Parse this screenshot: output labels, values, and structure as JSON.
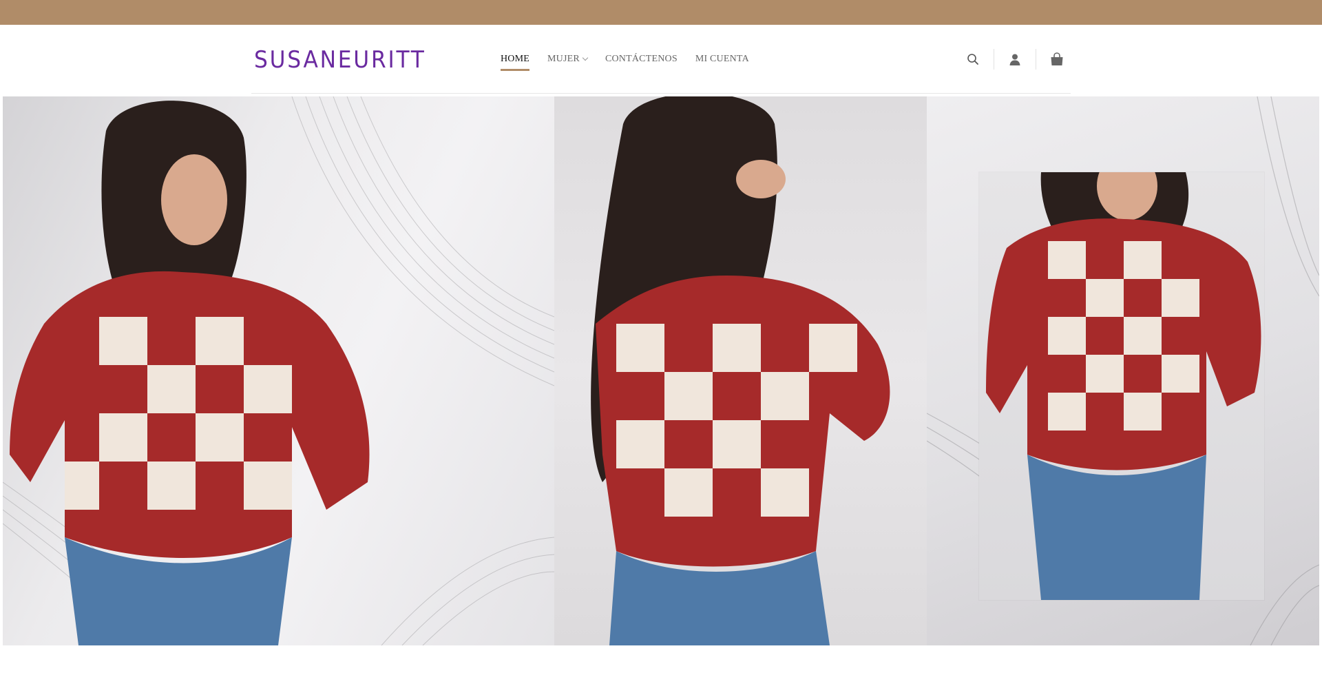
{
  "brand": {
    "logo_text": "SUSANEURITT",
    "logo_color": "#6a2aa0",
    "accent_color": "#b08c68"
  },
  "nav": {
    "items": [
      {
        "label": "HOME",
        "active": true
      },
      {
        "label": "MUJER",
        "has_dropdown": true
      },
      {
        "label": "CONTÁCTENOS"
      },
      {
        "label": "MI CUENTA"
      }
    ]
  },
  "header_icons": [
    "search-icon",
    "user-icon",
    "shopping-bag-icon"
  ],
  "hero": {
    "panels": [
      {
        "subject": "model-front-view",
        "sweater_color": "#a62a2a"
      },
      {
        "subject": "model-back-view",
        "sweater_color": "#a62a2a"
      },
      {
        "subject": "model-front-closeup",
        "sweater_color": "#a62a2a"
      }
    ]
  }
}
